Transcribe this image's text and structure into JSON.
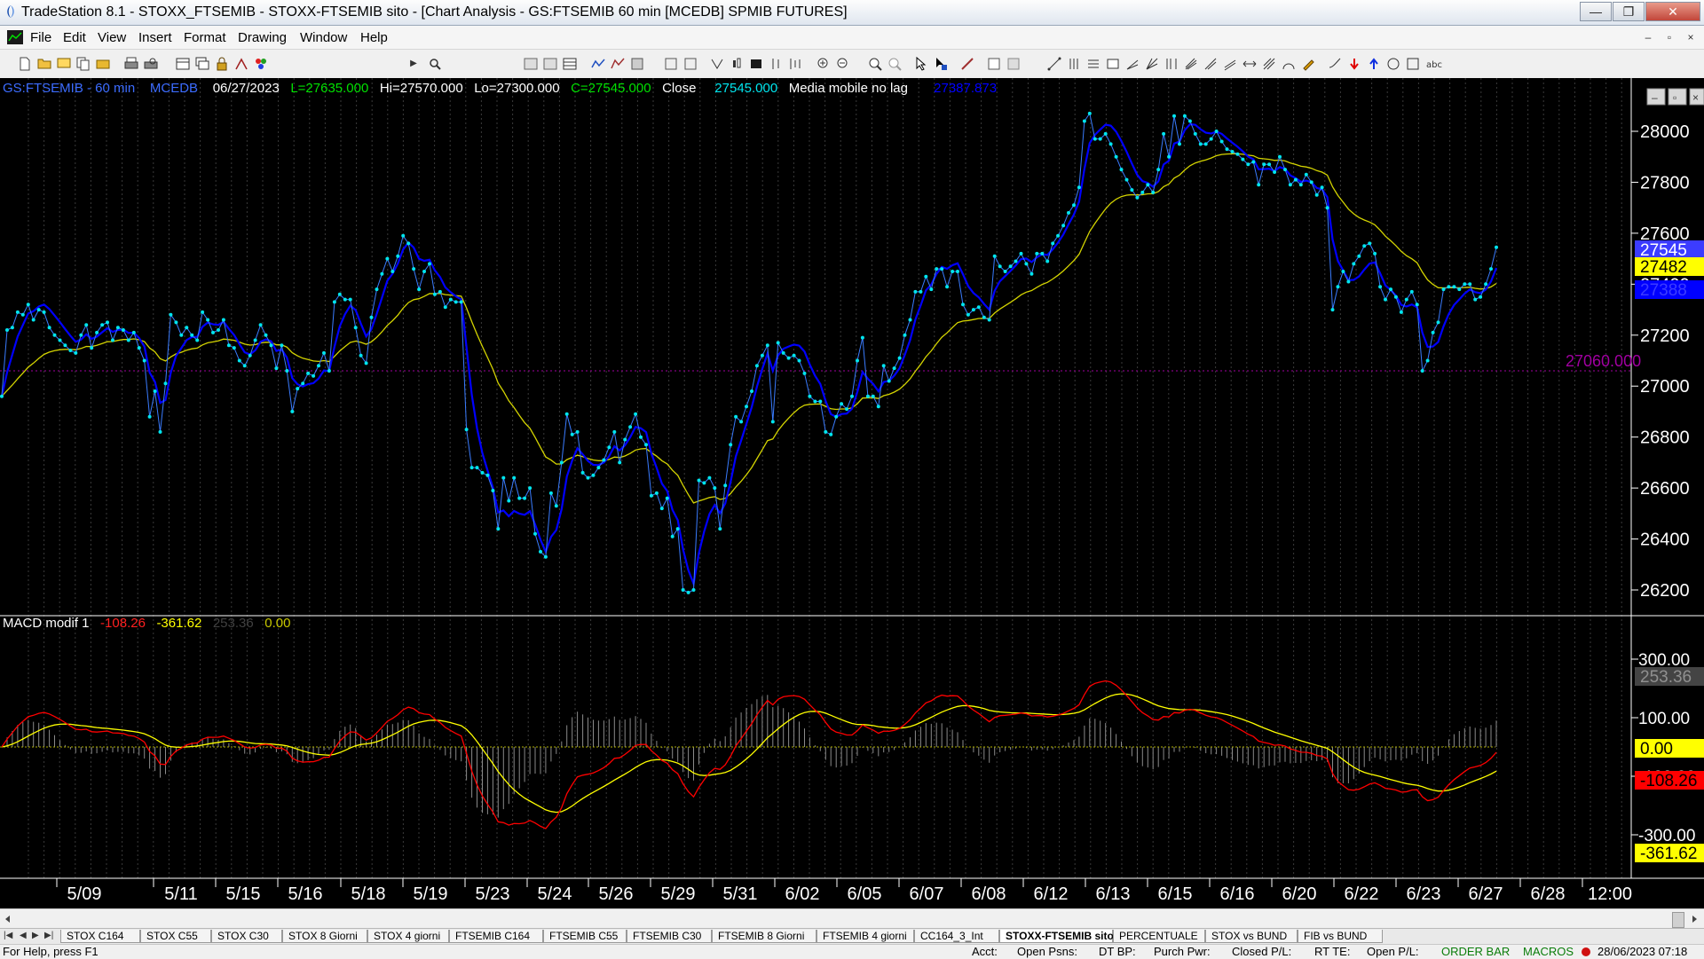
{
  "window": {
    "title": "TradeStation 8.1 - STOXX_FTSEMIB - STOXX-FTSEMIB sito - [Chart Analysis - GS:FTSEMIB  60 min  [MCEDB] SPMIB FUTURES]",
    "minimize": "—",
    "restore": "❐",
    "close": "✕"
  },
  "menu": {
    "items": [
      "File",
      "Edit",
      "View",
      "Insert",
      "Format",
      "Drawing",
      "Window",
      "Help"
    ],
    "mdi": [
      "–",
      "▫",
      "×"
    ]
  },
  "toolbar": {
    "symbol_value": "",
    "symbol_arrow": "▼",
    "play": "▶"
  },
  "chart": {
    "info": {
      "symbol": "GS:FTSEMIB - 60 min",
      "exchange": "MCEDB",
      "date": "06/27/2023",
      "open": "L=27635.000",
      "high": "Hi=27570.000",
      "low": "Lo=27300.000",
      "close_label": "C=27545.000",
      "close_word": "Close",
      "close_val": "27545.000",
      "ma_label": "Media mobile no lag",
      "ma_val": "27387.873"
    },
    "macd_info": {
      "name": "MACD modif 1",
      "v1": "-108.26",
      "v2": "-361.62",
      "v3": "253.36",
      "v4": "0.00"
    },
    "hline_label": "27060.000",
    "price_badges": [
      {
        "text": "27545",
        "bg": "#3c3cff",
        "fg": "#ffffff"
      },
      {
        "text": "27482",
        "bg": "#ffff00",
        "fg": "#000000"
      },
      {
        "text": "27388",
        "bg": "#0000ff",
        "fg": "#3c3cff"
      }
    ],
    "macd_badges": [
      {
        "text": "253.36",
        "bg": "#444444",
        "fg": "#909090"
      },
      {
        "text": "0.00",
        "bg": "#ffff00",
        "fg": "#000000"
      },
      {
        "text": "-108.26",
        "bg": "#ff0000",
        "fg": "#000000"
      },
      {
        "text": "-361.62",
        "bg": "#ffff00",
        "fg": "#000000"
      }
    ],
    "colors": {
      "price": "#00e5ee",
      "ma_blue": "#0000ff",
      "ma_yellow": "#d4d400",
      "macd": "#ff0000",
      "signal": "#ffff00",
      "hline": "#a000a0"
    }
  },
  "chart_data": {
    "type": "line",
    "price_axis": {
      "ticks": [
        28000,
        27800,
        27600,
        27400,
        27200,
        27000,
        26800,
        26600,
        26400,
        26200
      ],
      "range": [
        26100,
        28100
      ]
    },
    "macd_axis": {
      "ticks": [
        300,
        100,
        -100,
        -300
      ],
      "tick_labels": [
        "300.00",
        "100.00",
        "-100.00",
        "-300.00"
      ],
      "range": [
        -400,
        420
      ]
    },
    "date_labels": [
      "5/09",
      "5/11",
      "5/15",
      "5/16",
      "5/18",
      "5/19",
      "5/23",
      "5/24",
      "5/26",
      "5/29",
      "5/31",
      "6/02",
      "6/05",
      "6/07",
      "6/08",
      "6/12",
      "6/13",
      "6/15",
      "6/16",
      "6/20",
      "6/22",
      "6/23",
      "6/27",
      "6/28",
      "12:00"
    ],
    "hline": 27060,
    "close": [
      26960,
      27220,
      27230,
      27290,
      27280,
      27320,
      27260,
      27300,
      27290,
      27230,
      27200,
      27180,
      27160,
      27140,
      27130,
      27200,
      27240,
      27150,
      27210,
      27240,
      27250,
      27180,
      27230,
      27220,
      27180,
      27210,
      27150,
      27100,
      26880,
      26980,
      26820,
      27010,
      27280,
      27250,
      27200,
      27230,
      27200,
      27180,
      27290,
      27260,
      27210,
      27220,
      27260,
      27160,
      27150,
      27100,
      27080,
      27120,
      27180,
      27240,
      27200,
      27160,
      27070,
      27160,
      27060,
      26900,
      26990,
      27010,
      27050,
      27040,
      27080,
      27130,
      27060,
      27330,
      27360,
      27340,
      27340,
      27230,
      27120,
      27090,
      27270,
      27380,
      27440,
      27500,
      27450,
      27510,
      27590,
      27560,
      27460,
      27380,
      27450,
      27480,
      27360,
      27370,
      27310,
      27340,
      27330,
      27330,
      26830,
      26680,
      26680,
      26660,
      26650,
      26590,
      26440,
      26640,
      26550,
      26640,
      26560,
      26560,
      26600,
      26420,
      26350,
      26330,
      26580,
      26530,
      26700,
      26890,
      26810,
      26820,
      26660,
      26640,
      26650,
      26680,
      26710,
      26760,
      26820,
      26700,
      26790,
      26840,
      26890,
      26800,
      26770,
      26570,
      26580,
      26520,
      26560,
      26410,
      26440,
      26200,
      26190,
      26200,
      26630,
      26620,
      26640,
      26600,
      26440,
      26610,
      26770,
      26880,
      26860,
      26920,
      26980,
      27080,
      27120,
      27160,
      26860,
      27170,
      27130,
      27110,
      27120,
      27100,
      27050,
      26960,
      26940,
      26940,
      26820,
      26810,
      26880,
      26930,
      26910,
      26960,
      27100,
      27190,
      26960,
      26960,
      26920,
      27080,
      27020,
      27070,
      27110,
      27200,
      27260,
      27370,
      27370,
      27430,
      27380,
      27460,
      27460,
      27390,
      27450,
      27450,
      27320,
      27280,
      27300,
      27310,
      27270,
      27260,
      27510,
      27470,
      27450,
      27470,
      27490,
      27520,
      27480,
      27440,
      27520,
      27520,
      27490,
      27560,
      27590,
      27630,
      27680,
      27710,
      27780,
      28040,
      28070,
      27970,
      27970,
      27990,
      27950,
      27900,
      27850,
      27810,
      27770,
      27740,
      27760,
      27790,
      27760,
      27850,
      27990,
      27900,
      28060,
      27950,
      28060,
      28040,
      27990,
      27950,
      27950,
      27970,
      28000,
      27960,
      27930,
      27920,
      27910,
      27890,
      27870,
      27880,
      27790,
      27870,
      27870,
      27840,
      27900,
      27850,
      27790,
      27810,
      27790,
      27830,
      27800,
      27750,
      27780,
      27700,
      27300,
      27390,
      27450,
      27410,
      27480,
      27510,
      27550,
      27560,
      27520,
      27390,
      27340,
      27380,
      27350,
      27290,
      27340,
      27370,
      27320,
      27060,
      27100,
      27210,
      27250,
      27380,
      27390,
      27390,
      27380,
      27400,
      27400,
      27340,
      27350,
      27400,
      27460,
      27545
    ]
  }
}
